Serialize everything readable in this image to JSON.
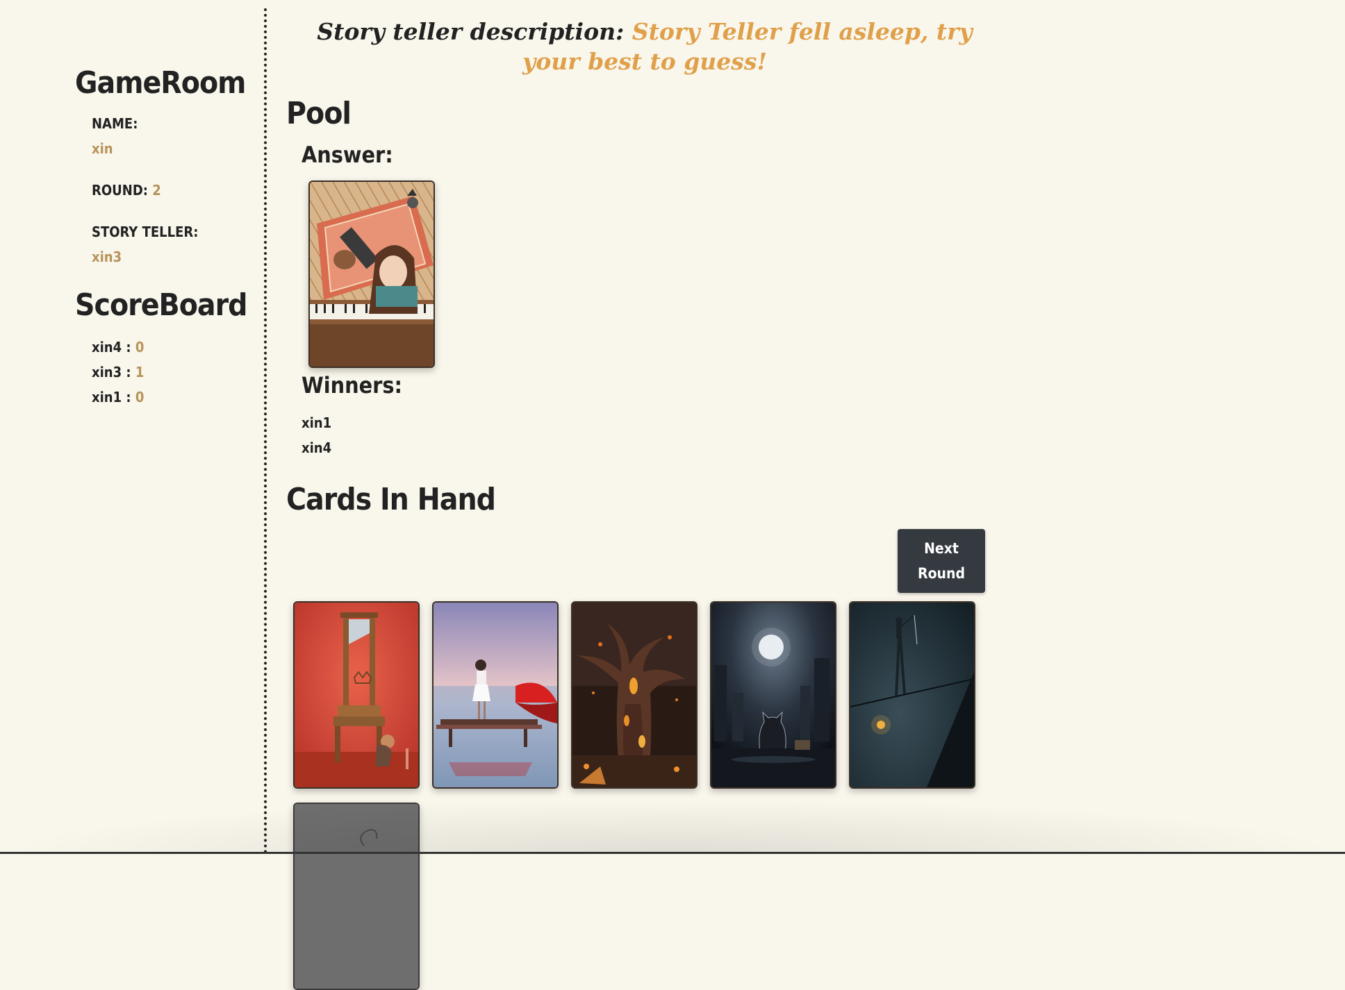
{
  "sidebar": {
    "gameroom_title": "GameRoom",
    "name_label": "NAME:",
    "name_value": "xin",
    "round_label": "ROUND:",
    "round_value": "2",
    "story_teller_label": "STORY TELLER:",
    "story_teller_value": "xin3",
    "scoreboard_title": "ScoreBoard",
    "scores": [
      {
        "player": "xin4",
        "sep": " : ",
        "score": "0"
      },
      {
        "player": "xin3",
        "sep": " : ",
        "score": "1"
      },
      {
        "player": "xin1",
        "sep": " : ",
        "score": "0"
      }
    ]
  },
  "main": {
    "description_label": "Story teller description:",
    "description_text": "Story Teller fell asleep, try your best to guess!",
    "pool_title": "Pool",
    "answer_label": "Answer:",
    "answer_card_icon": "girl-piano-card-image",
    "winners_label": "Winners:",
    "winners": [
      "xin1",
      "xin4"
    ],
    "cards_title": "Cards In Hand",
    "next_round_label": "Next Round",
    "hand_cards": [
      {
        "icon": "guillotine-chair-card-image"
      },
      {
        "icon": "girl-red-umbrella-card-image"
      },
      {
        "icon": "fantasy-tree-card-image"
      },
      {
        "icon": "cat-moon-card-image"
      },
      {
        "icon": "tightrope-walker-card-image"
      },
      {
        "icon": "partial-card-image"
      }
    ]
  },
  "colors": {
    "background": "#f9f6ec",
    "accent_value": "#b8935a",
    "description_accent": "#e0a04a",
    "button_bg": "#343a40",
    "text": "#222222"
  }
}
